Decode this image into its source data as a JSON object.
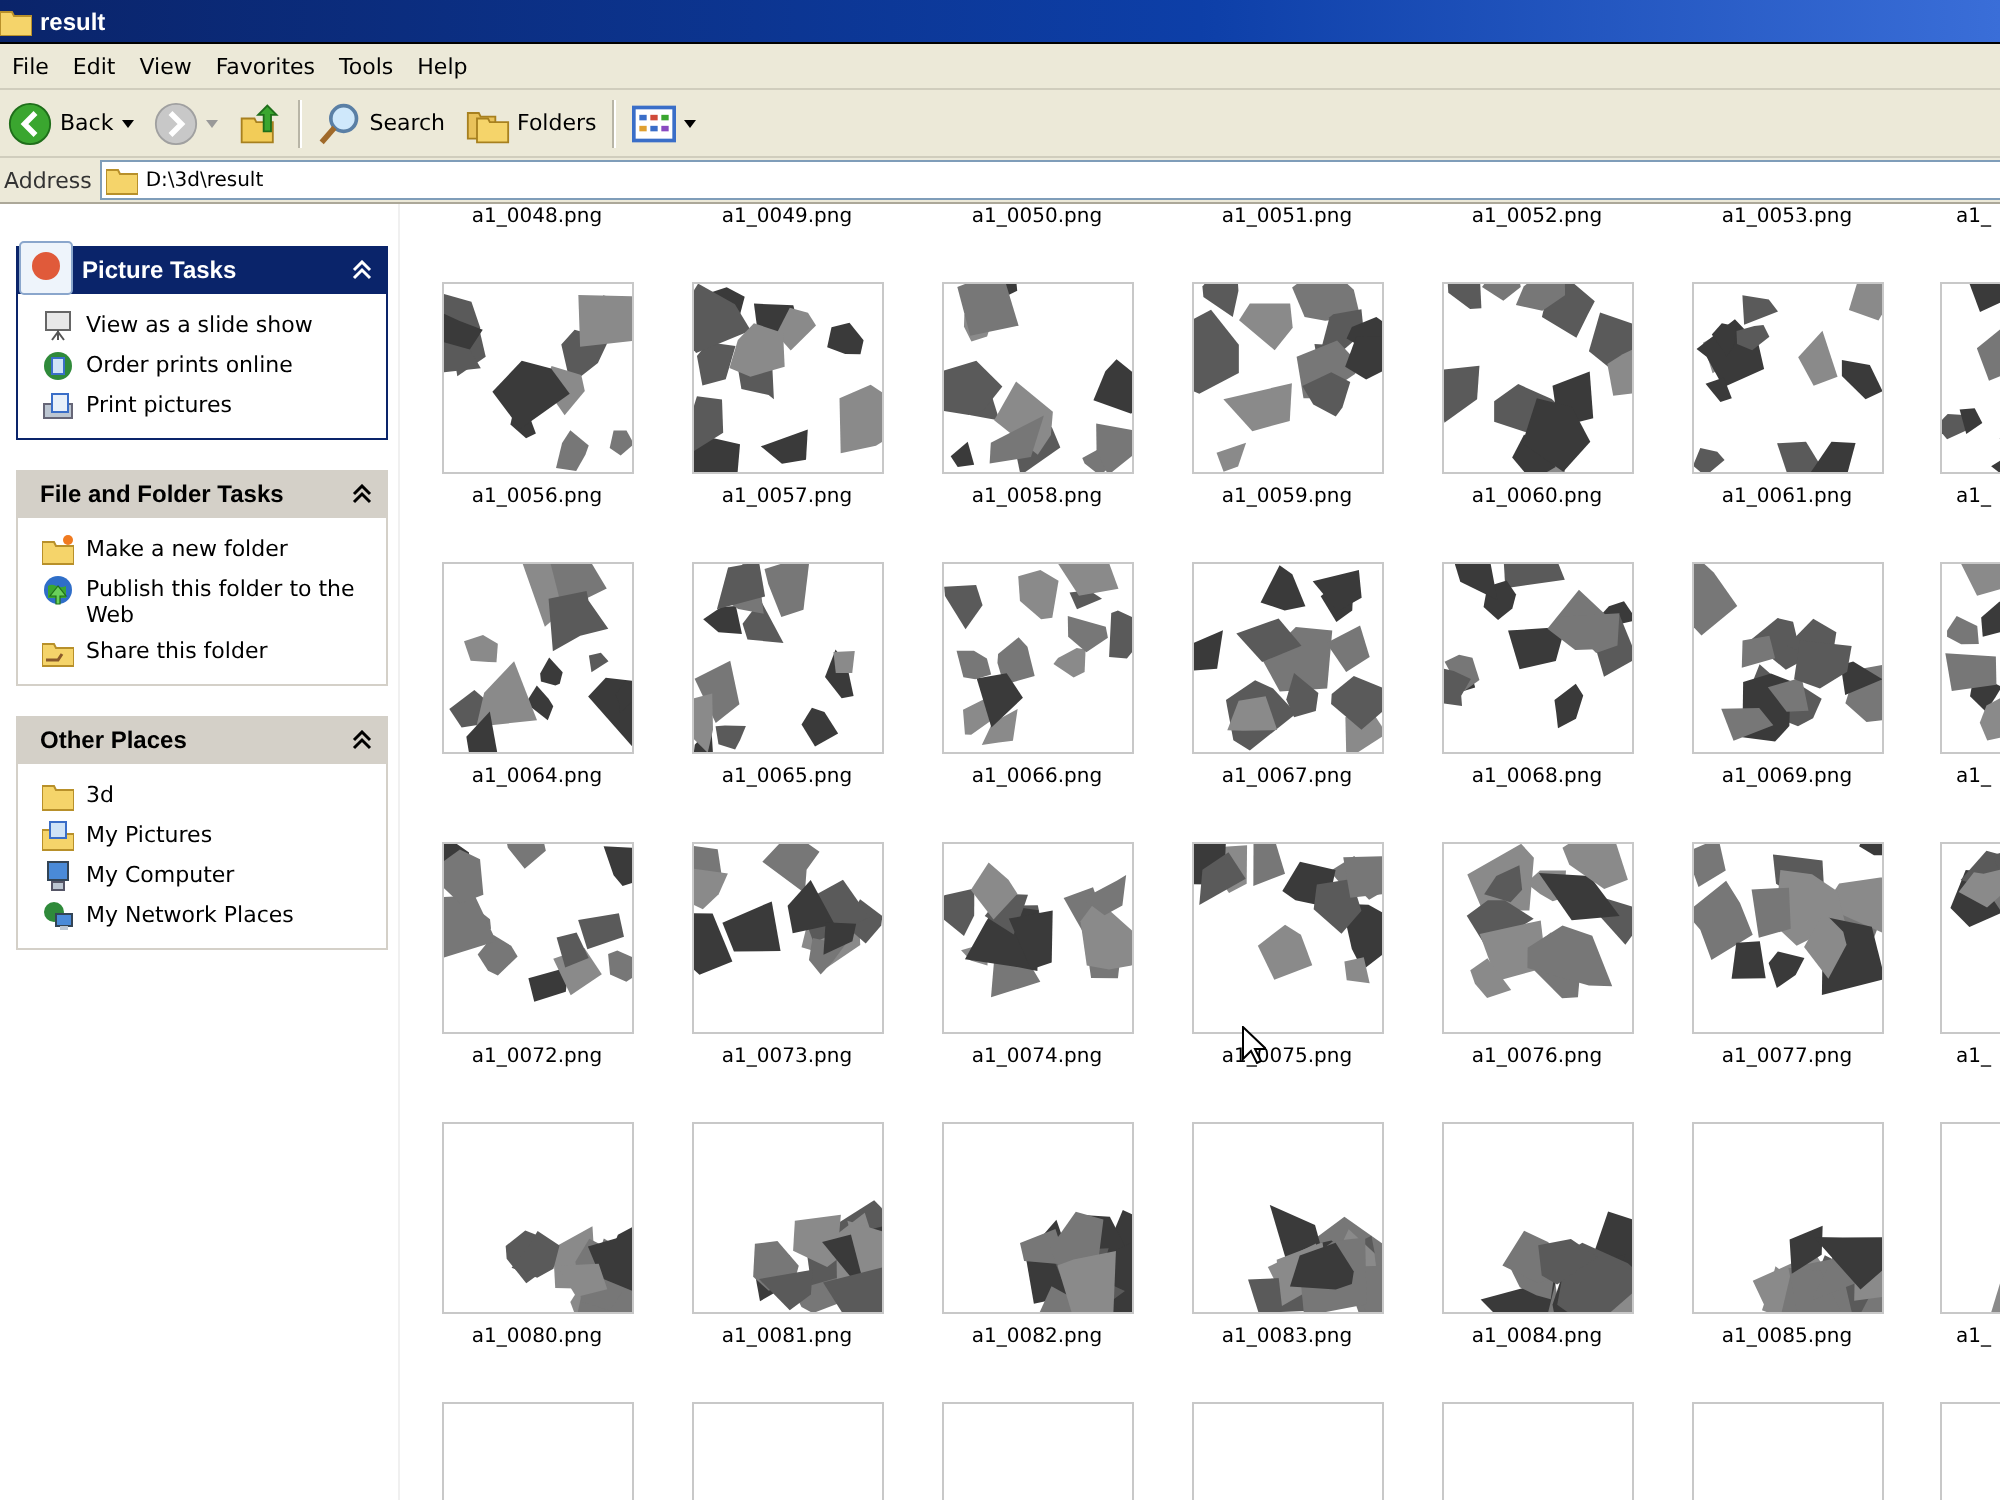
{
  "window": {
    "title": "result"
  },
  "menu": [
    "File",
    "Edit",
    "View",
    "Favorites",
    "Tools",
    "Help"
  ],
  "toolbar": [
    {
      "kind": "back",
      "label": "Back",
      "disabled": false
    },
    {
      "kind": "forward",
      "disabled": true
    },
    {
      "kind": "up"
    },
    {
      "kind": "search",
      "label": "Search"
    },
    {
      "kind": "folders",
      "label": "Folders"
    },
    {
      "kind": "views"
    }
  ],
  "address": {
    "label": "Address",
    "value": "D:\\3d\\result"
  },
  "task_panels": [
    {
      "title": "Picture Tasks",
      "kind": "special",
      "expanded": true,
      "items": [
        {
          "label": "View as a slide show"
        },
        {
          "label": "Order prints online"
        },
        {
          "label": "Print pictures"
        }
      ]
    },
    {
      "title": "File and Folder Tasks",
      "kind": "normal",
      "expanded": true,
      "items": [
        {
          "label": "Make a new folder"
        },
        {
          "label": "Publish this folder to the Web"
        },
        {
          "label": "Share this folder"
        }
      ]
    },
    {
      "title": "Other Places",
      "kind": "normal",
      "expanded": true,
      "items": [
        {
          "label": "3d"
        },
        {
          "label": "My Pictures"
        },
        {
          "label": "My Computer"
        },
        {
          "label": "My Network Places"
        }
      ]
    }
  ],
  "thumbnail_rows": [
    {
      "tiles": [
        {
          "name": "a1_0048.png"
        },
        {
          "name": "a1_0049.png"
        },
        {
          "name": "a1_0050.png"
        },
        {
          "name": "a1_0051.png"
        },
        {
          "name": "a1_0052.png"
        },
        {
          "name": "a1_0053.png"
        },
        {
          "name": "a1_"
        }
      ]
    },
    {
      "tiles": [
        {
          "kind": "picture",
          "name": "a1_0056.png"
        },
        {
          "kind": "picture",
          "name": "a1_0057.png"
        },
        {
          "kind": "picture",
          "name": "a1_0058.png"
        },
        {
          "kind": "picture",
          "name": "a1_0059.png"
        },
        {
          "kind": "picture",
          "name": "a1_0060.png"
        },
        {
          "kind": "picture",
          "name": "a1_0061.png"
        },
        {
          "kind": "picture",
          "name": "a1_"
        }
      ]
    },
    {
      "tiles": [
        {
          "kind": "picture",
          "name": "a1_0064.png"
        },
        {
          "kind": "picture",
          "name": "a1_0065.png"
        },
        {
          "kind": "picture",
          "name": "a1_0066.png"
        },
        {
          "kind": "picture",
          "name": "a1_0067.png"
        },
        {
          "kind": "picture",
          "name": "a1_0068.png"
        },
        {
          "kind": "picture",
          "name": "a1_0069.png"
        },
        {
          "kind": "picture",
          "name": "a1_"
        }
      ]
    },
    {
      "tiles": [
        {
          "kind": "picture",
          "name": "a1_0072.png"
        },
        {
          "kind": "picture",
          "name": "a1_0073.png"
        },
        {
          "kind": "picture",
          "name": "a1_0074.png"
        },
        {
          "kind": "picture",
          "name": "a1_0075.png"
        },
        {
          "kind": "picture",
          "name": "a1_0076.png"
        },
        {
          "kind": "picture",
          "name": "a1_0077.png"
        },
        {
          "kind": "picture",
          "name": "a1_"
        }
      ]
    },
    {
      "tiles": [
        {
          "kind": "picture",
          "name": "a1_0080.png"
        },
        {
          "kind": "picture",
          "name": "a1_0081.png"
        },
        {
          "kind": "picture",
          "name": "a1_0082.png"
        },
        {
          "kind": "picture",
          "name": "a1_0083.png"
        },
        {
          "kind": "picture",
          "name": "a1_0084.png"
        },
        {
          "kind": "picture",
          "name": "a1_0085.png"
        },
        {
          "kind": "picture",
          "name": "a1_"
        }
      ]
    },
    {
      "tiles": [
        {
          "kind": "blank"
        },
        {
          "kind": "blank"
        },
        {
          "kind": "blank"
        },
        {
          "kind": "blank"
        },
        {
          "kind": "blank"
        },
        {
          "kind": "blank"
        },
        {
          "kind": "blank"
        }
      ]
    }
  ]
}
